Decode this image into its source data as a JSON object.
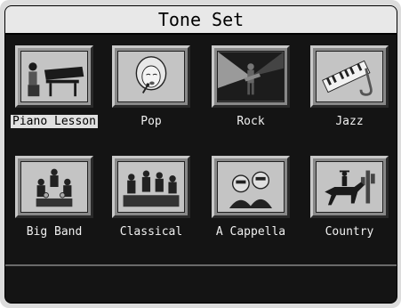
{
  "title": "Tone Set",
  "tiles": [
    {
      "label": "Piano Lesson",
      "icon": "piano-lesson-icon"
    },
    {
      "label": "Pop",
      "icon": "pop-singer-icon"
    },
    {
      "label": "Rock",
      "icon": "rock-guitarist-icon"
    },
    {
      "label": "Jazz",
      "icon": "jazz-keyboard-sax-icon"
    },
    {
      "label": "Big Band",
      "icon": "big-band-icon"
    },
    {
      "label": "Classical",
      "icon": "classical-orchestra-icon"
    },
    {
      "label": "A Cappella",
      "icon": "a-cappella-singers-icon"
    },
    {
      "label": "Country",
      "icon": "country-horse-rider-icon"
    }
  ],
  "selected_label": "Piano Lesson"
}
